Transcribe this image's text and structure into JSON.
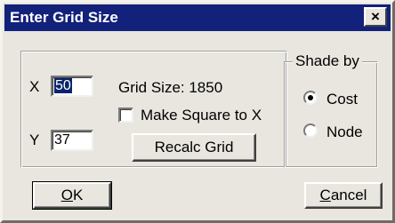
{
  "window": {
    "title": "Enter Grid Size",
    "close_label": "×"
  },
  "main_group": {
    "x_label": "X",
    "x_value": "50",
    "y_label": "Y",
    "y_value": "37",
    "grid_size_text": "Grid Size: 1850",
    "make_square_label": "Make Square to X",
    "make_square_checked": false,
    "recalc_button_label": "Recalc Grid"
  },
  "shade_group": {
    "legend": "Shade by",
    "options": [
      {
        "label": "Cost",
        "selected": true
      },
      {
        "label": "Node",
        "selected": false
      }
    ]
  },
  "buttons": {
    "ok_label": "OK",
    "cancel_label": "Cancel"
  }
}
